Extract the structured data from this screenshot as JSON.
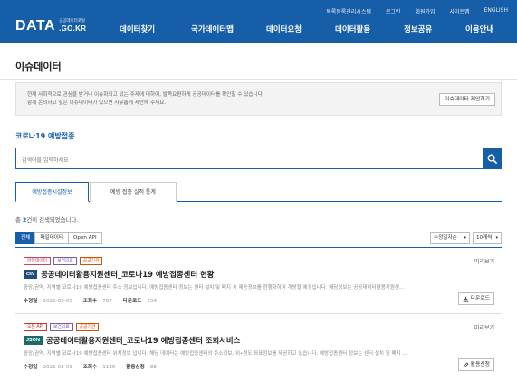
{
  "header": {
    "utility_links": [
      "목록등록관리시스템",
      "로그인",
      "회원가입",
      "사이트맵",
      "ENGLISH"
    ],
    "logo": {
      "main": "DATA",
      "small": "공공데이터포털",
      "domain": ".GO.KR"
    },
    "nav": [
      "데이터찾기",
      "국가데이터맵",
      "데이터요청",
      "데이터활용",
      "정보공유",
      "이용안내"
    ]
  },
  "page": {
    "title": "이슈데이터",
    "notice_line1": "현재 사회적으로 관심을 받거나 이슈화되고 있는 주제에 대하여, 발목요편하게 공공데이터를 확인할 수 있습니다.",
    "notice_line2": "함께 논의하고 싶은 이슈데이터가 있으면 자유롭게 제안해 주세요.",
    "suggest_button": "이슈데이터 제안하기"
  },
  "search": {
    "title": "코로나19 예방접종",
    "placeholder": "검색어를 입력하세요",
    "icon": "search-icon"
  },
  "tabs": [
    "예방접종시설정보",
    "예방 접종 실적 통계"
  ],
  "results": {
    "prefix": "총 ",
    "count": "2",
    "suffix": "건이 검색되었습니다."
  },
  "filters": [
    "전체",
    "파일데이터",
    "Open API"
  ],
  "sort": {
    "order": "수정일자순",
    "page_size": "10개씩"
  },
  "items": [
    {
      "badges": [
        "파일데이터",
        "보건의료",
        "공공기관"
      ],
      "format": "csv",
      "title": "공공데이터활용지원센터_코로나19 예방접종센터 현황",
      "desc": "중앙/권역, 지역별 코로나19 예방접종센터 주소 정보입니다. 예방접종센터 정보는 센터 설치 및 폐지 시 제공정보를 현행화하여 개방할 예정입니다. 해당정보는 공공데이터활용지원센...",
      "meta_label1": "수정일",
      "meta_value1": "2021-03-03",
      "meta_label2": "조회수",
      "meta_value2": "787",
      "meta_label3": "다운로드",
      "meta_value3": "154",
      "preview": "미리보기",
      "action": "다운로드",
      "action_icon": "download-icon"
    },
    {
      "badges": [
        "오픈 API",
        "보건의료",
        "공공기관"
      ],
      "format": "JSON",
      "title": "공공데이터활용지원센터_코로나19 예방접종센터 조회서비스",
      "desc": "중앙/권역, 지역별 코로나19 예방접종센터 위치정보 입니다. 해당 데이터는 예방접종센터의 주소정보, 위•경도 좌표정보를 제공하고 있습니다. 예방접종센터 정보는 센터 설치 및 폐지 ...",
      "meta_label1": "수정일",
      "meta_value1": "2021-03-03",
      "meta_label2": "조회수",
      "meta_value2": "1136",
      "meta_label3": "활용신청",
      "meta_value3": "88",
      "preview": "미리보기",
      "action": "활용신청",
      "action_icon": "edit-icon"
    }
  ],
  "colors": {
    "brand": "#175ea8",
    "csv_badge": "#1f4e79",
    "json_badge": "#1c6b6b",
    "file_badge": "#c44569",
    "api_badge": "#c0392b",
    "medical_badge": "#7d5aa8",
    "public_badge": "#d35400"
  }
}
